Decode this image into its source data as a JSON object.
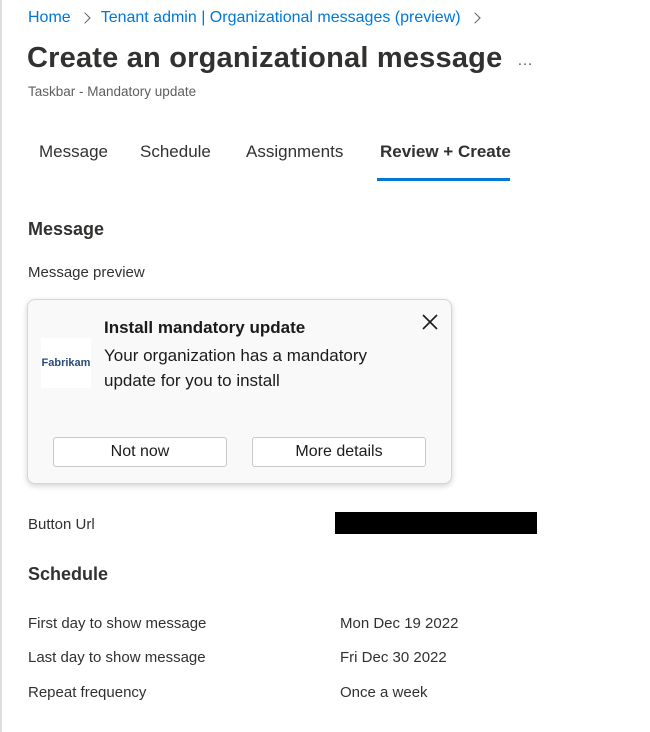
{
  "breadcrumb": {
    "items": [
      "Home",
      "Tenant admin | Organizational messages (preview)"
    ]
  },
  "header": {
    "title": "Create an organizational message",
    "subtitle": "Taskbar - Mandatory update",
    "more_glyph": "…"
  },
  "tabs": [
    {
      "label": "Message"
    },
    {
      "label": "Schedule"
    },
    {
      "label": "Assignments"
    },
    {
      "label": "Review + Create",
      "active": true
    }
  ],
  "message_section": {
    "heading": "Message",
    "preview_label": "Message preview",
    "toast": {
      "logo_text": "Fabrikam",
      "title": "Install mandatory update",
      "body": "Your organization has a mandatory update for you to install",
      "primary_button": "Not now",
      "secondary_button": "More details"
    },
    "button_url_label": "Button Url"
  },
  "schedule_section": {
    "heading": "Schedule",
    "rows": [
      {
        "label": "First day to show message",
        "value": "Mon Dec 19 2022"
      },
      {
        "label": "Last day to show message",
        "value": "Fri Dec 30 2022"
      },
      {
        "label": "Repeat frequency",
        "value": "Once a week"
      }
    ]
  },
  "colors": {
    "accent": "#0078d4",
    "text": "#323130",
    "redaction": "#000000"
  }
}
